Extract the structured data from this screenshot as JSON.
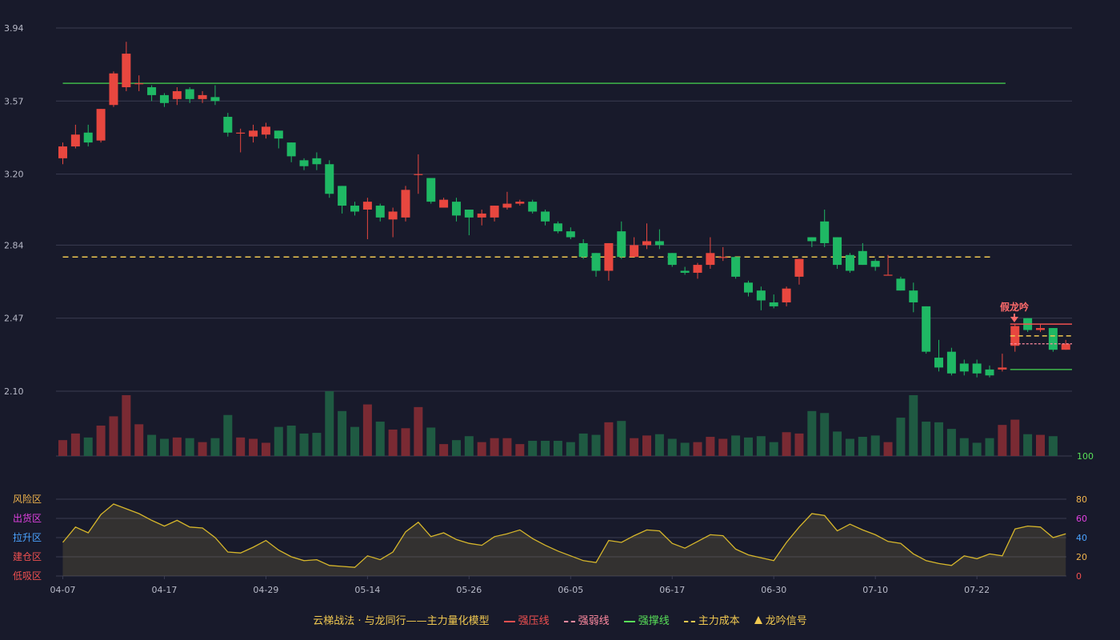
{
  "chart_data": {
    "type": "candlestick",
    "x_ticks": [
      "04-07",
      "04-17",
      "04-29",
      "05-14",
      "05-26",
      "06-05",
      "06-17",
      "06-30",
      "07-10",
      "07-22"
    ],
    "x_tick_indices": [
      0,
      8,
      16,
      24,
      32,
      40,
      48,
      56,
      64,
      72
    ],
    "price_axis": {
      "ticks": [
        "3.94",
        "3.57",
        "3.20",
        "2.84",
        "2.47",
        "2.10"
      ],
      "range": [
        2.1,
        3.94
      ]
    },
    "candles": [
      [
        3.28,
        3.34,
        3.25,
        3.36
      ],
      [
        3.34,
        3.4,
        3.33,
        3.45
      ],
      [
        3.41,
        3.36,
        3.34,
        3.45
      ],
      [
        3.37,
        3.53,
        3.36,
        3.53
      ],
      [
        3.55,
        3.71,
        3.54,
        3.72
      ],
      [
        3.64,
        3.81,
        3.62,
        3.87
      ],
      [
        3.66,
        3.66,
        3.62,
        3.7
      ],
      [
        3.64,
        3.6,
        3.57,
        3.65
      ],
      [
        3.6,
        3.56,
        3.54,
        3.61
      ],
      [
        3.58,
        3.62,
        3.55,
        3.64
      ],
      [
        3.63,
        3.58,
        3.56,
        3.64
      ],
      [
        3.58,
        3.6,
        3.56,
        3.62
      ],
      [
        3.59,
        3.57,
        3.55,
        3.65
      ],
      [
        3.49,
        3.41,
        3.39,
        3.51
      ],
      [
        3.41,
        3.41,
        3.31,
        3.43
      ],
      [
        3.39,
        3.42,
        3.36,
        3.45
      ],
      [
        3.4,
        3.44,
        3.38,
        3.46
      ],
      [
        3.42,
        3.38,
        3.33,
        3.42
      ],
      [
        3.36,
        3.29,
        3.26,
        3.36
      ],
      [
        3.27,
        3.24,
        3.22,
        3.28
      ],
      [
        3.28,
        3.25,
        3.22,
        3.31
      ],
      [
        3.25,
        3.1,
        3.08,
        3.27
      ],
      [
        3.14,
        3.04,
        3.0,
        3.14
      ],
      [
        3.04,
        3.01,
        2.99,
        3.06
      ],
      [
        3.02,
        3.06,
        2.87,
        3.08
      ],
      [
        3.04,
        2.98,
        2.96,
        3.05
      ],
      [
        2.97,
        3.01,
        2.88,
        3.03
      ],
      [
        2.98,
        3.12,
        2.96,
        3.14
      ],
      [
        3.2,
        3.2,
        3.1,
        3.3
      ],
      [
        3.18,
        3.06,
        3.05,
        3.18
      ],
      [
        3.03,
        3.07,
        3.05,
        3.08
      ],
      [
        3.06,
        2.99,
        2.96,
        3.08
      ],
      [
        3.02,
        2.98,
        2.89,
        3.02
      ],
      [
        2.98,
        3.0,
        2.94,
        3.02
      ],
      [
        2.98,
        3.04,
        2.96,
        3.04
      ],
      [
        3.03,
        3.05,
        3.02,
        3.11
      ],
      [
        3.05,
        3.06,
        3.04,
        3.07
      ],
      [
        3.06,
        3.01,
        3.0,
        3.07
      ],
      [
        3.01,
        2.96,
        2.94,
        3.02
      ],
      [
        2.95,
        2.91,
        2.9,
        2.96
      ],
      [
        2.91,
        2.88,
        2.87,
        2.93
      ],
      [
        2.85,
        2.78,
        2.77,
        2.87
      ],
      [
        2.8,
        2.71,
        2.68,
        2.8
      ],
      [
        2.71,
        2.85,
        2.66,
        2.85
      ],
      [
        2.91,
        2.78,
        2.77,
        2.96
      ],
      [
        2.78,
        2.84,
        2.79,
        2.88
      ],
      [
        2.84,
        2.86,
        2.82,
        2.95
      ],
      [
        2.86,
        2.84,
        2.82,
        2.92
      ],
      [
        2.8,
        2.74,
        2.73,
        2.8
      ],
      [
        2.71,
        2.7,
        2.69,
        2.73
      ],
      [
        2.7,
        2.74,
        2.67,
        2.75
      ],
      [
        2.74,
        2.8,
        2.72,
        2.88
      ],
      [
        2.78,
        2.78,
        2.76,
        2.83
      ],
      [
        2.78,
        2.68,
        2.67,
        2.78
      ],
      [
        2.65,
        2.6,
        2.58,
        2.66
      ],
      [
        2.61,
        2.56,
        2.51,
        2.63
      ],
      [
        2.55,
        2.53,
        2.52,
        2.59
      ],
      [
        2.55,
        2.62,
        2.53,
        2.63
      ],
      [
        2.68,
        2.77,
        2.64,
        2.77
      ],
      [
        2.88,
        2.86,
        2.83,
        2.88
      ],
      [
        2.96,
        2.85,
        2.83,
        3.02
      ],
      [
        2.88,
        2.74,
        2.72,
        2.88
      ],
      [
        2.79,
        2.71,
        2.7,
        2.8
      ],
      [
        2.81,
        2.74,
        2.74,
        2.85
      ],
      [
        2.76,
        2.73,
        2.71,
        2.77
      ],
      [
        2.69,
        2.69,
        2.69,
        2.79
      ],
      [
        2.67,
        2.61,
        2.61,
        2.68
      ],
      [
        2.61,
        2.55,
        2.5,
        2.65
      ],
      [
        2.53,
        2.3,
        2.29,
        2.53
      ],
      [
        2.27,
        2.22,
        2.2,
        2.36
      ],
      [
        2.3,
        2.19,
        2.18,
        2.32
      ],
      [
        2.24,
        2.2,
        2.18,
        2.26
      ],
      [
        2.24,
        2.19,
        2.17,
        2.26
      ],
      [
        2.21,
        2.18,
        2.17,
        2.23
      ],
      [
        2.21,
        2.22,
        2.2,
        2.29
      ],
      [
        2.33,
        2.43,
        2.3,
        2.44
      ],
      [
        2.47,
        2.41,
        2.4,
        2.47
      ],
      [
        2.41,
        2.42,
        2.4,
        2.44
      ],
      [
        2.42,
        2.31,
        2.3,
        2.42
      ],
      [
        2.31,
        2.34,
        2.31,
        2.36
      ]
    ],
    "volumes": [
      24,
      34,
      28,
      46,
      60,
      92,
      48,
      32,
      26,
      28,
      27,
      21,
      27,
      62,
      28,
      26,
      20,
      44,
      46,
      34,
      35,
      98,
      68,
      44,
      78,
      52,
      40,
      42,
      74,
      43,
      18,
      24,
      30,
      21,
      27,
      27,
      18,
      23,
      23,
      23,
      21,
      34,
      32,
      51,
      53,
      27,
      31,
      33,
      26,
      20,
      21,
      29,
      26,
      31,
      28,
      30,
      21,
      36,
      34,
      68,
      65,
      37,
      26,
      29,
      31,
      21,
      58,
      92,
      52,
      51,
      41,
      27,
      20,
      27,
      47,
      55,
      33,
      32,
      30
    ],
    "volume_axis_tick": "100",
    "resistance_line": {
      "price": 3.66,
      "from_index": 0,
      "to_index": 74
    },
    "main_cost_line": {
      "price": 2.78,
      "from_index": 0,
      "to_index": 73
    },
    "dragon_signal": {
      "index": 75,
      "label": "假龙吟",
      "strong_pressure": 2.44,
      "weak_line": 2.34,
      "cost": 2.38,
      "support": 2.21
    },
    "oscillator": {
      "zones": [
        "风险区",
        "出货区",
        "拉升区",
        "建仓区",
        "低吸区"
      ],
      "zone_colors": [
        "#f0b44c",
        "#e040e0",
        "#4aa3ff",
        "#f05050",
        "#f05050"
      ],
      "ticks": [
        "80",
        "60",
        "40",
        "20",
        "0"
      ],
      "tick_colors": [
        "#f0b44c",
        "#e040e0",
        "#4aa3ff",
        "#f0b44c",
        "#f05050"
      ],
      "values": [
        35,
        51,
        45,
        64,
        75,
        70,
        65,
        58,
        52,
        58,
        51,
        50,
        40,
        25,
        24,
        30,
        37,
        27,
        20,
        16,
        17,
        11,
        10,
        9,
        21,
        17,
        25,
        46,
        56,
        41,
        45,
        38,
        34,
        32,
        41,
        44,
        48,
        39,
        32,
        26,
        21,
        16,
        14,
        37,
        35,
        42,
        48,
        47,
        34,
        29,
        36,
        43,
        42,
        28,
        22,
        19,
        16,
        35,
        51,
        65,
        63,
        47,
        54,
        48,
        43,
        36,
        34,
        23,
        16,
        13,
        11,
        21,
        18,
        23,
        21,
        49,
        52,
        51,
        40,
        44
      ]
    },
    "legend": [
      {
        "label": "云梯战法 · 与龙同行——主力量化模型",
        "color": "#f0c850",
        "kind": "text"
      },
      {
        "label": "强压线",
        "color": "#f05050",
        "kind": "line"
      },
      {
        "label": "强弱线",
        "color": "#ff8aa0",
        "kind": "dash"
      },
      {
        "label": "强撑线",
        "color": "#58e058",
        "kind": "line"
      },
      {
        "label": "主力成本",
        "color": "#f0c850",
        "kind": "dash"
      },
      {
        "label": "龙吟信号",
        "color": "#f0c850",
        "kind": "triangle"
      }
    ],
    "colors": {
      "up": "#e8473f",
      "down": "#1fb864",
      "volume_up": "#7a2a33",
      "volume_down": "#1f5a42",
      "grid": "#3a3c52",
      "axis_text": "#b8bac8",
      "oscillator_line": "#d6b62b",
      "volume_tick": "#58e058"
    }
  }
}
